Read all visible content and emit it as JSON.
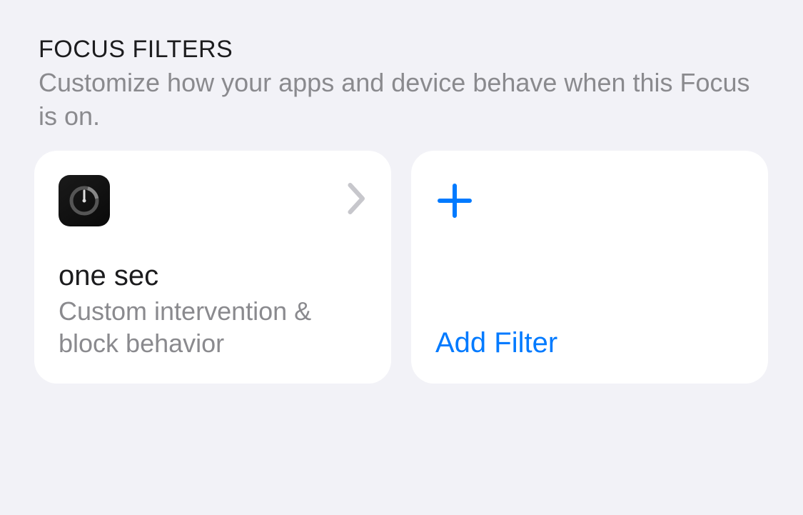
{
  "section": {
    "title": "FOCUS FILTERS",
    "description": "Customize how your apps and device behave when this Focus is on."
  },
  "filters": [
    {
      "app_name": "one sec",
      "subtitle": "Custom intervention & block behavior",
      "icon": "one-sec-app-icon"
    }
  ],
  "add_filter": {
    "label": "Add Filter"
  }
}
